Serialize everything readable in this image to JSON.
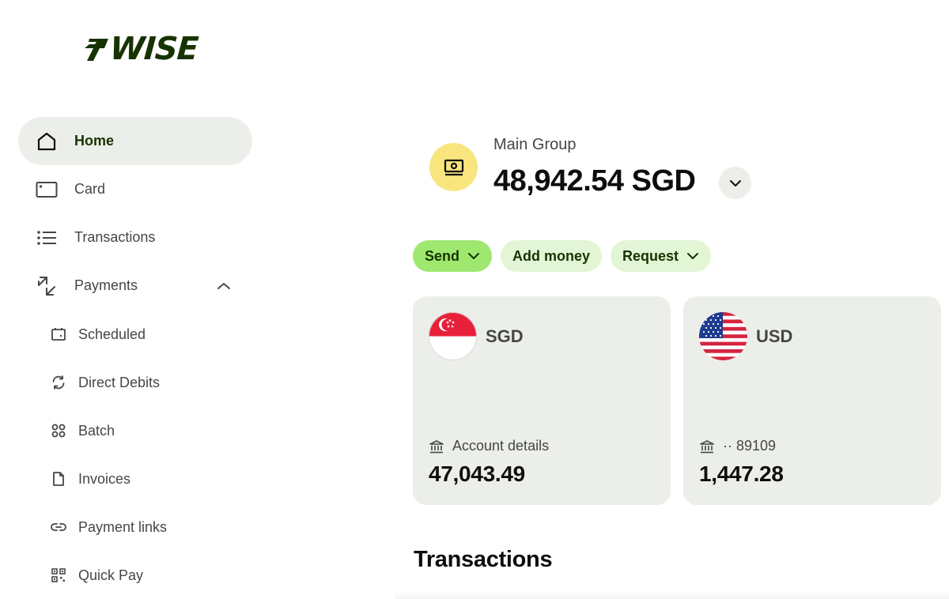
{
  "logo": {
    "text": "WISE",
    "brand_color": "#163300"
  },
  "sidebar": {
    "items": [
      {
        "label": "Home",
        "icon": "home-icon",
        "active": true
      },
      {
        "label": "Card",
        "icon": "card-icon"
      },
      {
        "label": "Transactions",
        "icon": "list-icon"
      },
      {
        "label": "Payments",
        "icon": "payments-icon",
        "expanded": true
      }
    ],
    "payments_sub": [
      {
        "label": "Scheduled",
        "icon": "calendar-icon"
      },
      {
        "label": "Direct Debits",
        "icon": "refresh-icon"
      },
      {
        "label": "Batch",
        "icon": "batch-icon"
      },
      {
        "label": "Invoices",
        "icon": "document-icon"
      },
      {
        "label": "Payment links",
        "icon": "link-icon"
      },
      {
        "label": "Quick Pay",
        "icon": "qr-icon"
      }
    ]
  },
  "main": {
    "group_name": "Main Group",
    "group_balance": "48,942.54 SGD",
    "group_icon": "cash-icon",
    "actions": [
      {
        "label": "Send",
        "has_dropdown": true,
        "primary": true
      },
      {
        "label": "Add money",
        "has_dropdown": false
      },
      {
        "label": "Request",
        "has_dropdown": true
      }
    ],
    "accounts": [
      {
        "currency": "SGD",
        "flag": "singapore-flag-icon",
        "detail": "Account details",
        "amount": "47,043.49"
      },
      {
        "currency": "USD",
        "flag": "us-flag-icon",
        "detail": "·· 89109",
        "amount": "1,447.28"
      }
    ],
    "transactions_title": "Transactions"
  },
  "colors": {
    "accent_green": "#9fe870",
    "light_green": "#e2f6d5",
    "forest": "#163300",
    "group_yellow": "#f8e57e",
    "card_bg": "#eceeea"
  }
}
